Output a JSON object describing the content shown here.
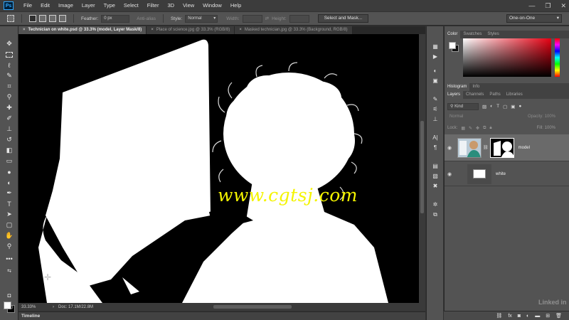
{
  "app": {
    "logo": "Ps"
  },
  "menu": [
    "File",
    "Edit",
    "Image",
    "Layer",
    "Type",
    "Select",
    "Filter",
    "3D",
    "View",
    "Window",
    "Help"
  ],
  "window_controls": {
    "minimize": "—",
    "restore": "❐",
    "close": "✕"
  },
  "options_bar": {
    "feather_label": "Feather:",
    "feather_value": "0 px",
    "antialias_label": "Anti-alias",
    "style_label": "Style:",
    "style_value": "Normal",
    "width_label": "Width:",
    "height_label": "Height:",
    "select_and_mask": "Select and Mask...",
    "workspace": "One-on-One"
  },
  "tabs": [
    {
      "label": "Technician on white.psd @ 33.3% (model, Layer Mask/8)",
      "active": true
    },
    {
      "label": "Place of science.jpg @ 33.3% (RGB/8)",
      "active": false
    },
    {
      "label": "Masked technician.jpg @ 33.3% (Background, RGB/8)",
      "active": false
    }
  ],
  "tools": [
    "move-icon",
    "marquee-icon",
    "lasso-icon",
    "quick-select-icon",
    "crop-icon",
    "eyedropper-icon",
    "healing-icon",
    "brush-icon",
    "stamp-icon",
    "history-brush-icon",
    "eraser-icon",
    "gradient-icon",
    "blur-icon",
    "dodge-icon",
    "pen-icon",
    "type-icon",
    "path-select-icon",
    "rectangle-icon",
    "hand-icon",
    "zoom-icon",
    "more-tools-icon"
  ],
  "canvas": {
    "watermark": "www.cgtsj.com"
  },
  "status": {
    "zoom": "33.33%",
    "doc": "Doc: 17.1M/22.8M"
  },
  "timeline": "Timeline",
  "color_panel": {
    "tabs": [
      "Color",
      "Swatches",
      "Styles"
    ]
  },
  "histogram_panel": {
    "tabs": [
      "Histogram",
      "Info"
    ]
  },
  "layers_panel": {
    "tabs": [
      "Layers",
      "Channels",
      "Paths",
      "Libraries"
    ],
    "kind": "Kind",
    "blend_mode": "Normal",
    "opacity_label": "Opacity:",
    "opacity_value": "100%",
    "lock_label": "Lock:",
    "fill_label": "Fill:",
    "fill_value": "100%",
    "layers": [
      {
        "name": "model",
        "selected": true
      },
      {
        "name": "white",
        "selected": false
      }
    ]
  },
  "brand_mark": "Linked in"
}
